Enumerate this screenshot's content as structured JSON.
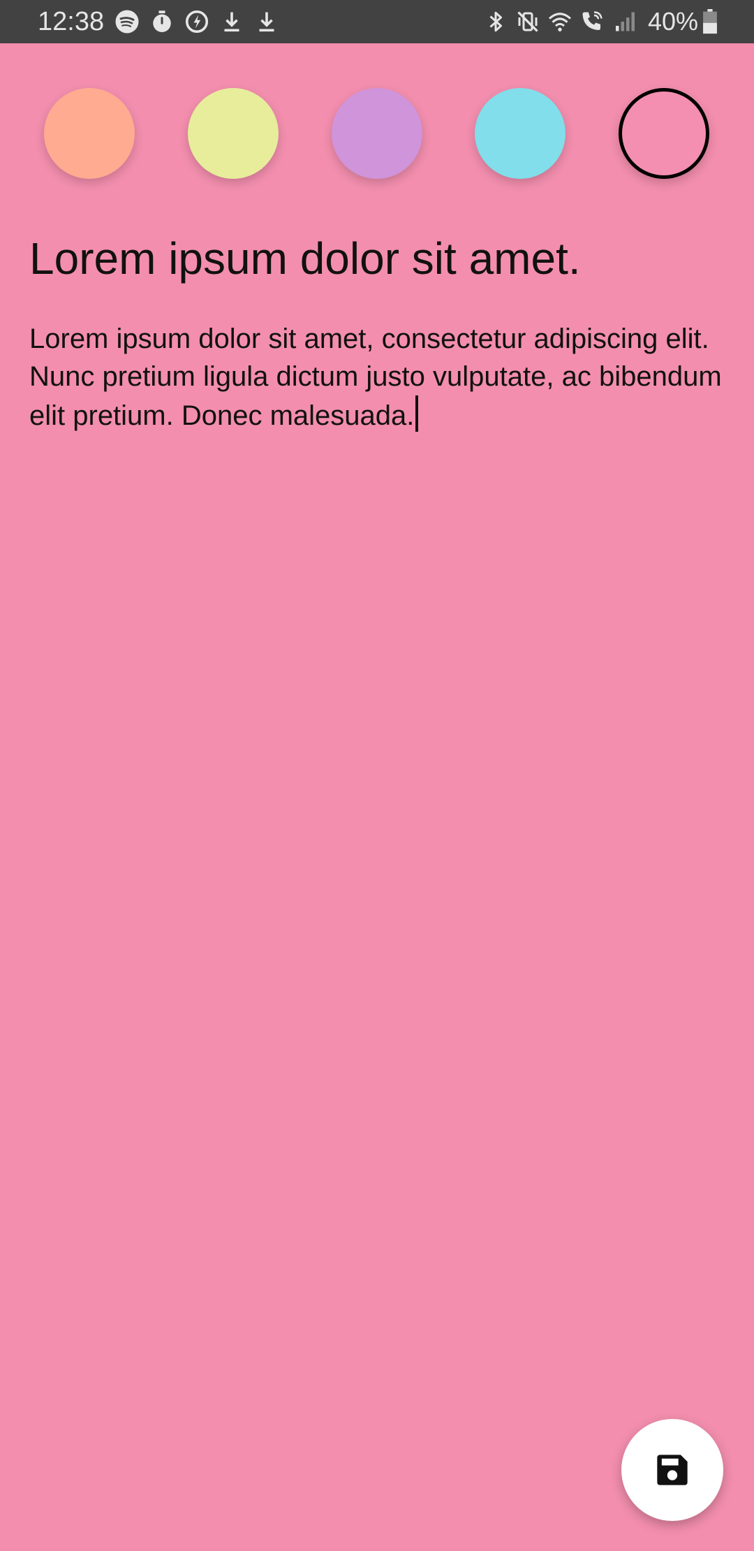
{
  "status_bar": {
    "time": "12:38",
    "left_icons": [
      "spotify-icon",
      "timer-icon",
      "power-save-icon",
      "download-icon",
      "download-icon"
    ],
    "right_icons": [
      "bluetooth-icon",
      "vibrate-mute-icon",
      "wifi-icon",
      "wifi-calling-icon",
      "signal-icon"
    ],
    "battery": "40%"
  },
  "color_picker": {
    "swatches": [
      {
        "color": "#ffab91",
        "selected": false
      },
      {
        "color": "#e7ed9b",
        "selected": false
      },
      {
        "color": "#cf94da",
        "selected": false
      },
      {
        "color": "#81deea",
        "selected": false
      },
      {
        "color": "#f48fb1",
        "selected": true
      }
    ]
  },
  "note": {
    "title": "Lorem ipsum dolor sit amet.",
    "body": "Lorem ipsum dolor sit amet, consectetur adipiscing elit. Nunc pretium ligula dictum justo vulputate, ac bibendum elit pretium. Donec malesuada."
  },
  "fab": {
    "icon": "save-icon"
  },
  "colors": {
    "background": "#f38eae",
    "status_bar": "#424242",
    "fab": "#ffffff"
  }
}
